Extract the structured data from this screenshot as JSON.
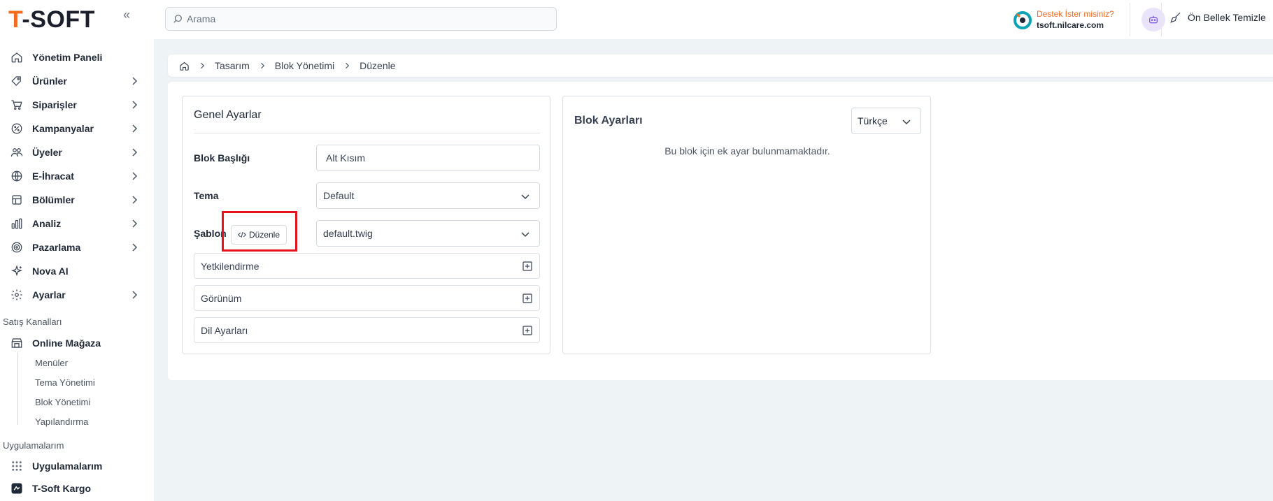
{
  "brand": {
    "logo_prefix": "T",
    "logo_rest": "-SOFT"
  },
  "colors": {
    "accent": "#f26b21",
    "highlight": "#e4141c"
  },
  "sidebar": {
    "items": [
      {
        "label": "Yönetim Paneli",
        "icon": "home-icon",
        "has_chevron": false
      },
      {
        "label": "Ürünler",
        "icon": "tag-icon",
        "has_chevron": true
      },
      {
        "label": "Siparişler",
        "icon": "cart-icon",
        "has_chevron": true
      },
      {
        "label": "Kampanyalar",
        "icon": "discount-icon",
        "has_chevron": true
      },
      {
        "label": "Üyeler",
        "icon": "users-icon",
        "has_chevron": true
      },
      {
        "label": "E-İhracat",
        "icon": "globe-icon",
        "has_chevron": true
      },
      {
        "label": "Bölümler",
        "icon": "layout-icon",
        "has_chevron": true
      },
      {
        "label": "Analiz",
        "icon": "chart-icon",
        "has_chevron": true
      },
      {
        "label": "Pazarlama",
        "icon": "target-icon",
        "has_chevron": true
      },
      {
        "label": "Nova AI",
        "icon": "sparkle-icon",
        "has_chevron": false
      },
      {
        "label": "Ayarlar",
        "icon": "gear-icon",
        "has_chevron": true
      }
    ],
    "sales_channels_label": "Satış Kanalları",
    "online_store": "Online Mağaza",
    "online_store_sub": [
      "Menüler",
      "Tema Yönetimi",
      "Blok Yönetimi",
      "Yapılandırma"
    ],
    "apps_label": "Uygulamalarım",
    "apps_item": "Uygulamalarım",
    "cargo_item": "T-Soft Kargo"
  },
  "topbar": {
    "search_placeholder": "Arama",
    "support_title": "Destek İster misiniz?",
    "support_domain": "tsoft.nilcare.com",
    "cache_label": "Ön Bellek Temizle"
  },
  "breadcrumb": [
    "Tasarım",
    "Blok Yönetimi",
    "Düzenle"
  ],
  "general": {
    "title": "Genel Ayarlar",
    "block_title_label": "Blok Başlığı",
    "block_title_value": "Alt Kısım",
    "theme_label": "Tema",
    "theme_value": "Default",
    "template_label": "Şablon",
    "template_edit_button": "Düzenle",
    "template_value": "default.twig",
    "accordions": [
      "Yetkilendirme",
      "Görünüm",
      "Dil Ayarları"
    ]
  },
  "block_settings": {
    "title": "Blok Ayarları",
    "language": "Türkçe",
    "empty_message": "Bu blok için ek ayar bulunmamaktadır."
  }
}
